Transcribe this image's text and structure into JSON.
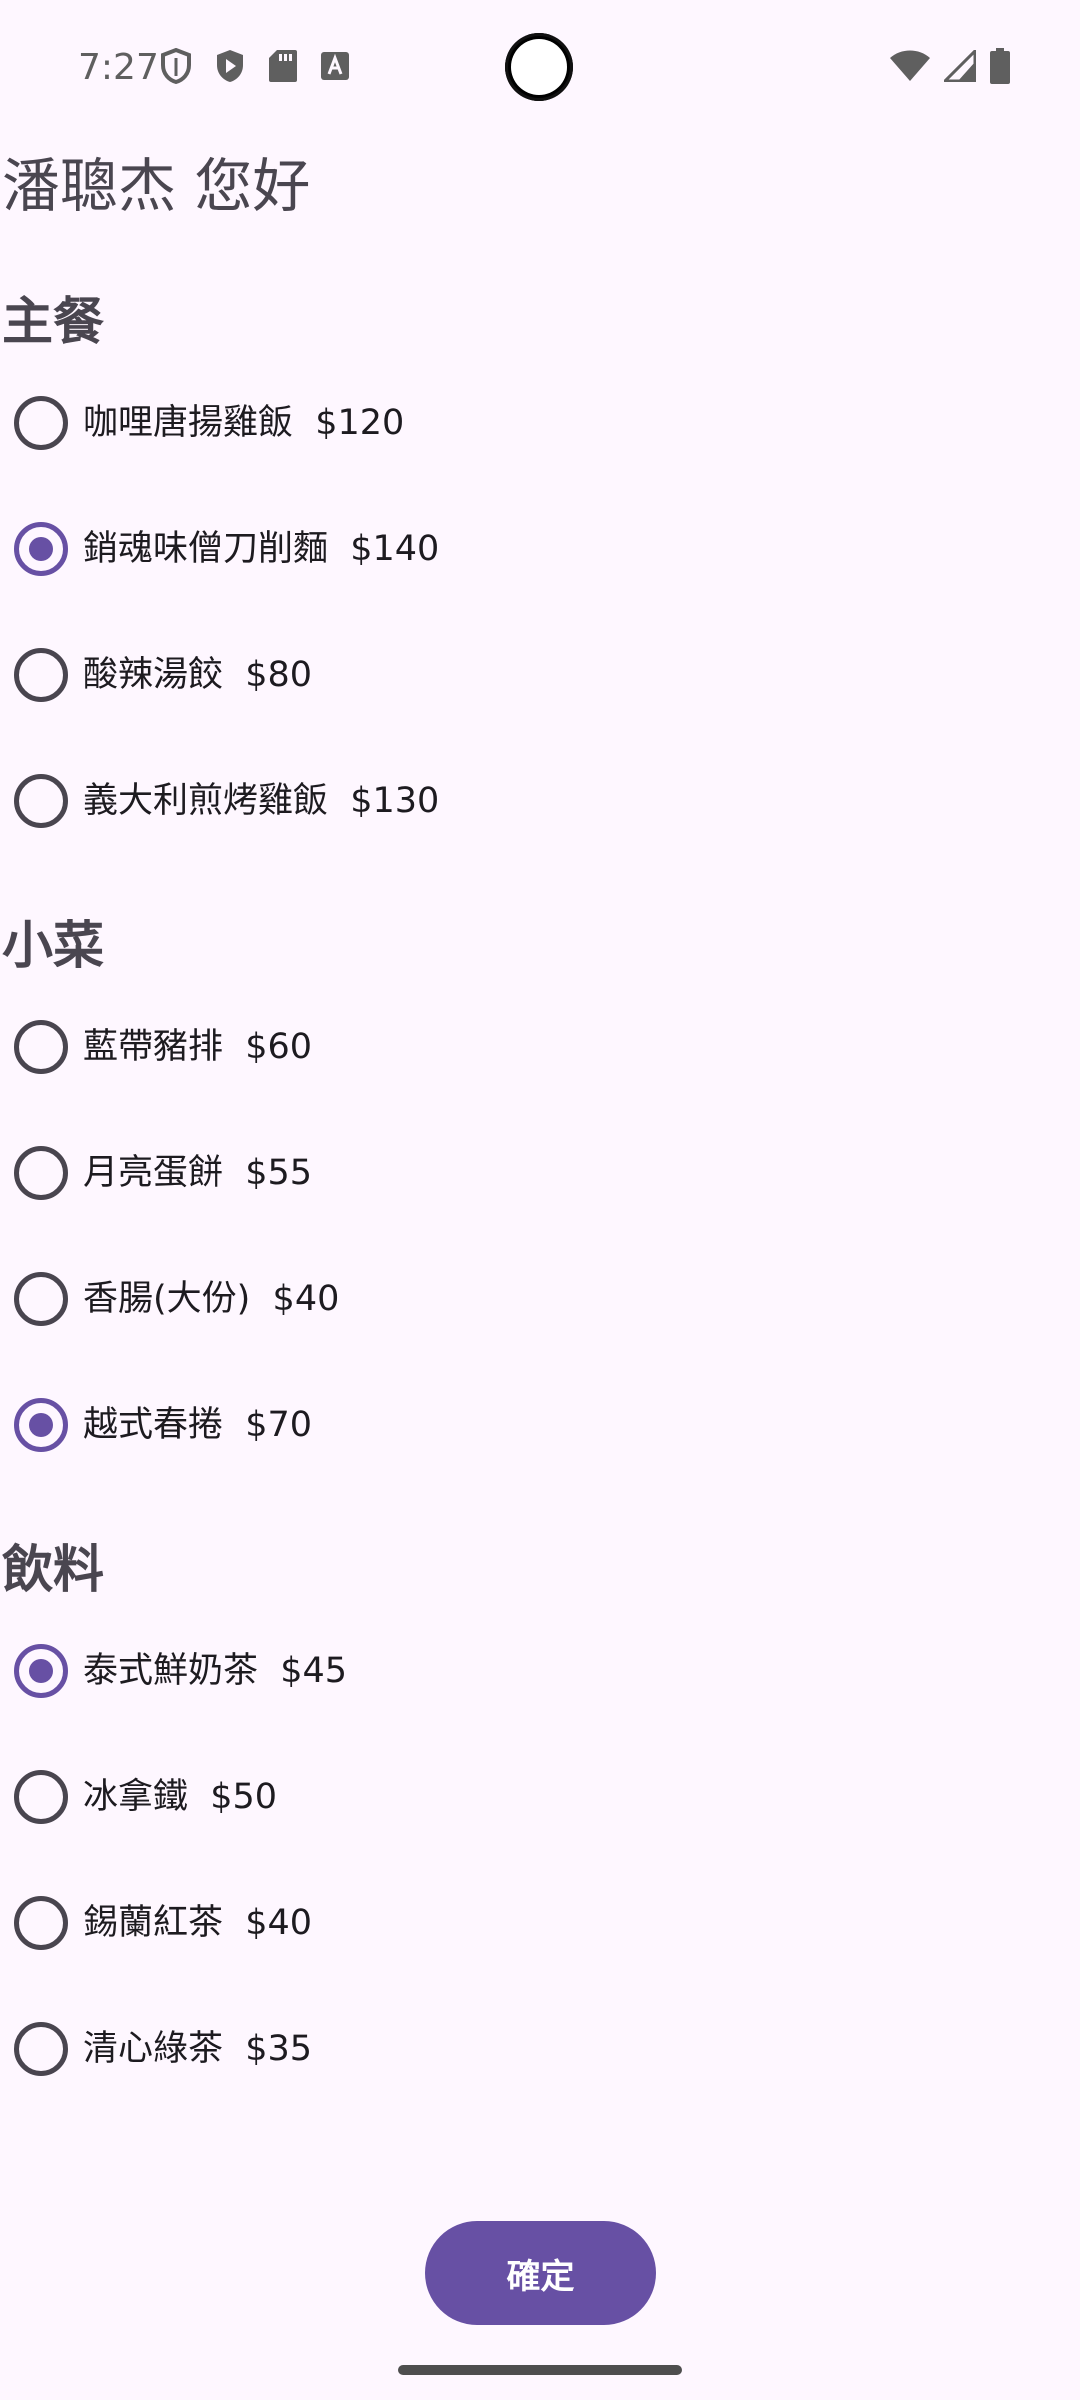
{
  "status_bar": {
    "time": "7:27",
    "left_icons": [
      "shield-outline-icon",
      "play-shield-icon",
      "sd-card-icon",
      "a-notification-icon"
    ],
    "right_icons": [
      "wifi-icon",
      "signal-icon",
      "battery-icon"
    ]
  },
  "greeting": "潘聰杰 您好",
  "sections": [
    {
      "title": "主餐",
      "items": [
        {
          "label": "咖哩唐揚雞飯  $120",
          "checked": false
        },
        {
          "label": "銷魂味僧刀削麵  $140",
          "checked": true
        },
        {
          "label": "酸辣湯餃  $80",
          "checked": false
        },
        {
          "label": "義大利煎烤雞飯  $130",
          "checked": false
        }
      ]
    },
    {
      "title": "小菜",
      "items": [
        {
          "label": "藍帶豬排  $60",
          "checked": false
        },
        {
          "label": "月亮蛋餅  $55",
          "checked": false
        },
        {
          "label": "香腸(大份)  $40",
          "checked": false
        },
        {
          "label": "越式春捲  $70",
          "checked": true
        }
      ]
    },
    {
      "title": "飲料",
      "items": [
        {
          "label": "泰式鮮奶茶  $45",
          "checked": true
        },
        {
          "label": "冰拿鐵  $50",
          "checked": false
        },
        {
          "label": "錫蘭紅茶  $40",
          "checked": false
        },
        {
          "label": "清心綠茶  $35",
          "checked": false
        }
      ]
    }
  ],
  "confirm_label": "確定",
  "colors": {
    "background": "#FEF7FF",
    "accent": "#6750A4",
    "radio_unchecked": "#49454F",
    "section_text": "#4A4650"
  }
}
